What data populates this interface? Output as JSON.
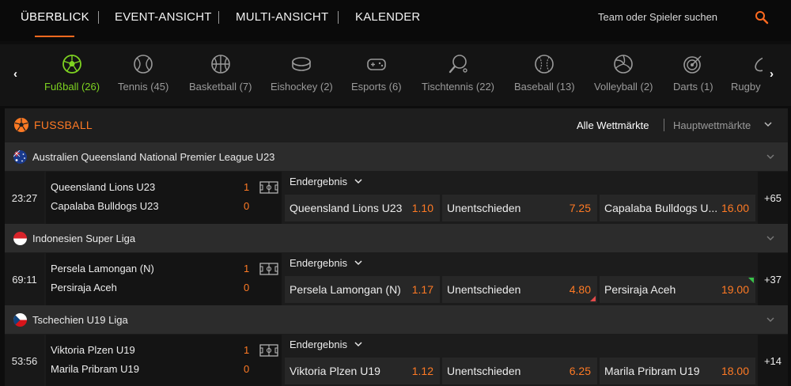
{
  "nav": {
    "tabs": [
      "ÜBERBLICK",
      "EVENT-ANSICHT",
      "MULTI-ANSICHT",
      "KALENDER"
    ],
    "search_placeholder": "Team oder Spieler suchen"
  },
  "sports": [
    {
      "label": "Fußball (26)",
      "icon": "soccer-ball-icon",
      "active": true
    },
    {
      "label": "Tennis (45)",
      "icon": "tennis-ball-icon"
    },
    {
      "label": "Basketball (7)",
      "icon": "basketball-icon"
    },
    {
      "label": "Eishockey (2)",
      "icon": "hockey-puck-icon"
    },
    {
      "label": "Esports (6)",
      "icon": "gamepad-icon"
    },
    {
      "label": "Tischtennis (22)",
      "icon": "table-tennis-paddle-icon"
    },
    {
      "label": "Baseball (13)",
      "icon": "baseball-icon"
    },
    {
      "label": "Volleyball (2)",
      "icon": "volleyball-icon"
    },
    {
      "label": "Darts (1)",
      "icon": "darts-target-icon"
    },
    {
      "label": "Rugby",
      "icon": "rugby-ball-icon"
    }
  ],
  "section": {
    "title": "FUSSBALL",
    "market_all": "Alle Wettmärkte",
    "market_main": "Hauptwettmärkte"
  },
  "accent_color": "#ff7a24",
  "leagues": [
    {
      "name": "Australien Queensland National Premier League U23",
      "flag": "australia-flag-icon",
      "match": {
        "time": "23:27",
        "home": "Queensland Lions U23",
        "away": "Capalaba Bulldogs U23",
        "home_score": "1",
        "away_score": "0",
        "market": "Endergebnis",
        "odds": [
          {
            "name": "Queensland Lions U23",
            "price": "1.10"
          },
          {
            "name": "Unentschieden",
            "price": "7.25"
          },
          {
            "name": "Capalaba Bulldogs U...",
            "price": "16.00"
          }
        ],
        "more": "+65"
      }
    },
    {
      "name": "Indonesien Super Liga",
      "flag": "indonesia-flag-icon",
      "match": {
        "time": "69:11",
        "home": "Persela Lamongan (N)",
        "away": "Persiraja Aceh",
        "home_score": "1",
        "away_score": "0",
        "market": "Endergebnis",
        "odds": [
          {
            "name": "Persela Lamongan (N)",
            "price": "1.17"
          },
          {
            "name": "Unentschieden",
            "price": "4.80",
            "trend": "down"
          },
          {
            "name": "Persiraja Aceh",
            "price": "19.00",
            "trend": "up"
          }
        ],
        "more": "+37"
      }
    },
    {
      "name": "Tschechien U19 Liga",
      "flag": "czech-flag-icon",
      "match": {
        "time": "53:56",
        "home": "Viktoria Plzen U19",
        "away": "Marila Pribram U19",
        "home_score": "1",
        "away_score": "0",
        "market": "Endergebnis",
        "odds": [
          {
            "name": "Viktoria Plzen U19",
            "price": "1.12"
          },
          {
            "name": "Unentschieden",
            "price": "6.25"
          },
          {
            "name": "Marila Pribram U19",
            "price": "18.00"
          }
        ],
        "more": "+14"
      }
    }
  ]
}
